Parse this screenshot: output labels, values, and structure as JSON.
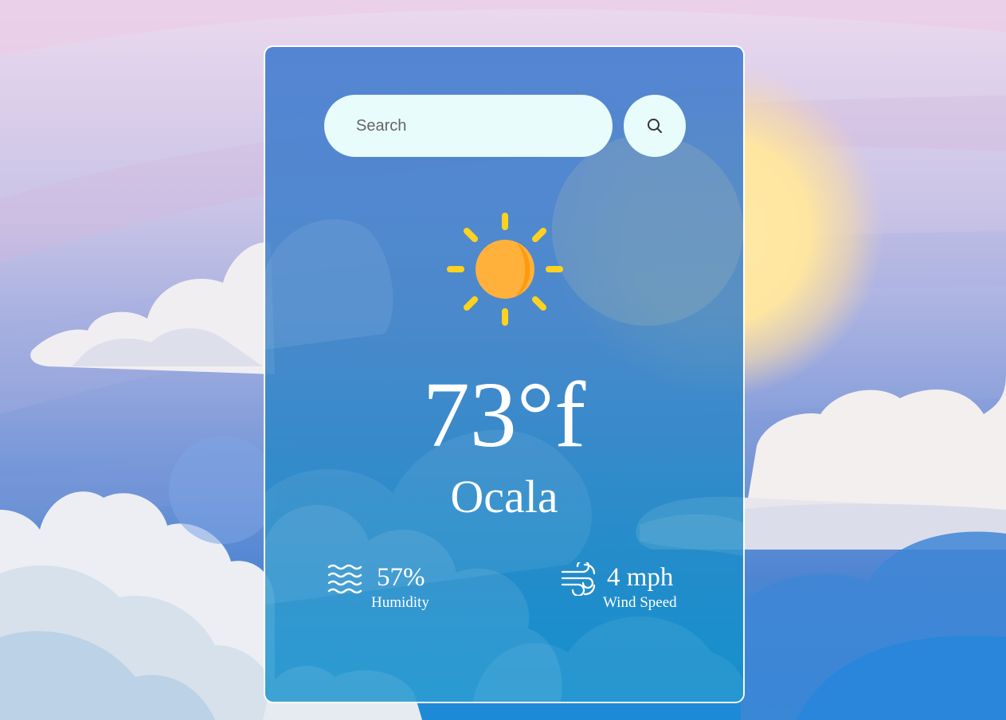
{
  "colors": {
    "card_border": "#ffffff",
    "input_background": "#e8fcfb",
    "sun_body": "#ffb13b",
    "sun_rays": "#ffd21f",
    "text": "#ffffff"
  },
  "search": {
    "placeholder": "Search",
    "value": "",
    "icon": "search-icon"
  },
  "weather": {
    "icon": "sun-icon",
    "temperature": "73°f",
    "city": "Ocala"
  },
  "details": {
    "humidity": {
      "icon": "humidity-waves-icon",
      "value": "57%",
      "label": "Humidity"
    },
    "wind": {
      "icon": "wind-icon",
      "value": "4 mph",
      "label": "Wind Speed"
    }
  }
}
